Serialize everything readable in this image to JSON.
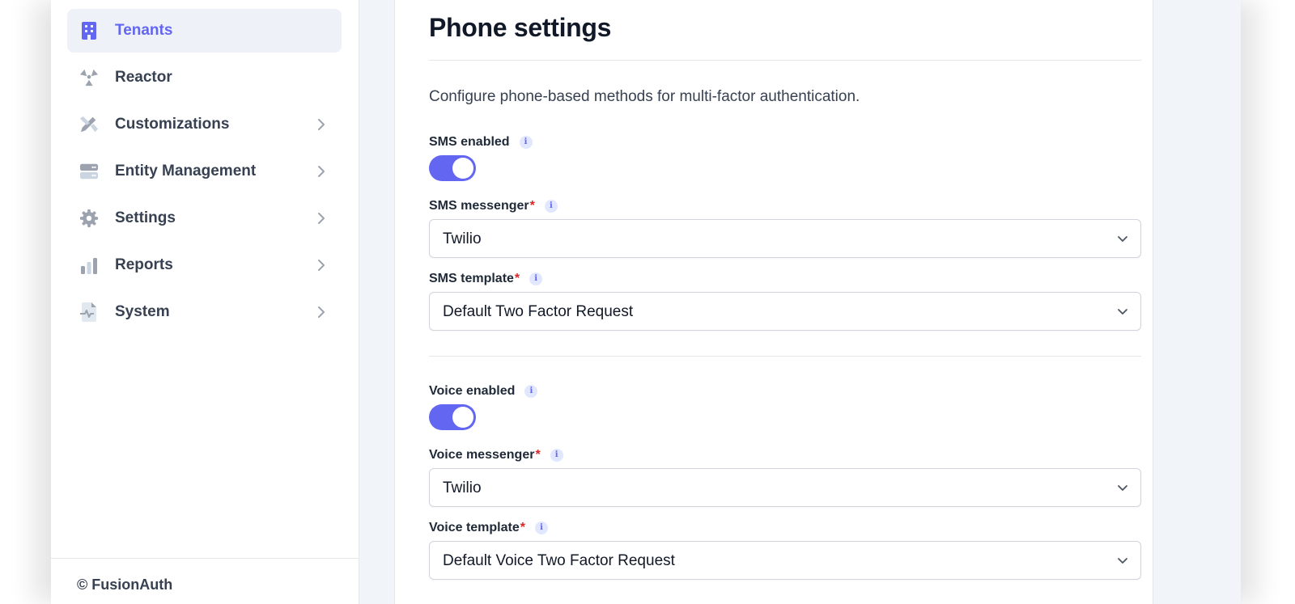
{
  "sidebar": {
    "items": [
      {
        "label": "Tenants",
        "icon": "building-icon",
        "active": true
      },
      {
        "label": "Reactor",
        "icon": "radiation-icon"
      },
      {
        "label": "Customizations",
        "icon": "pencil-ruler-icon"
      },
      {
        "label": "Entity Management",
        "icon": "server-icon"
      },
      {
        "label": "Settings",
        "icon": "gear-icon"
      },
      {
        "label": "Reports",
        "icon": "bar-chart-icon"
      },
      {
        "label": "System",
        "icon": "file-pulse-icon"
      }
    ],
    "footer": "© FusionAuth"
  },
  "main": {
    "title": "Phone settings",
    "description": "Configure phone-based methods for multi-factor authentication.",
    "sms": {
      "enabled_label": "SMS enabled",
      "enabled": true,
      "messenger_label": "SMS messenger",
      "messenger_value": "Twilio",
      "template_label": "SMS template",
      "template_value": "Default Two Factor Request"
    },
    "voice": {
      "enabled_label": "Voice enabled",
      "enabled": true,
      "messenger_label": "Voice messenger",
      "messenger_value": "Twilio",
      "template_label": "Voice template",
      "template_value": "Default Voice Two Factor Request"
    },
    "required_mark": "*",
    "info_mark": "i"
  },
  "colors": {
    "accent": "#6366f1",
    "required": "#dc2626",
    "nav_active_bg": "#eef2f8"
  }
}
